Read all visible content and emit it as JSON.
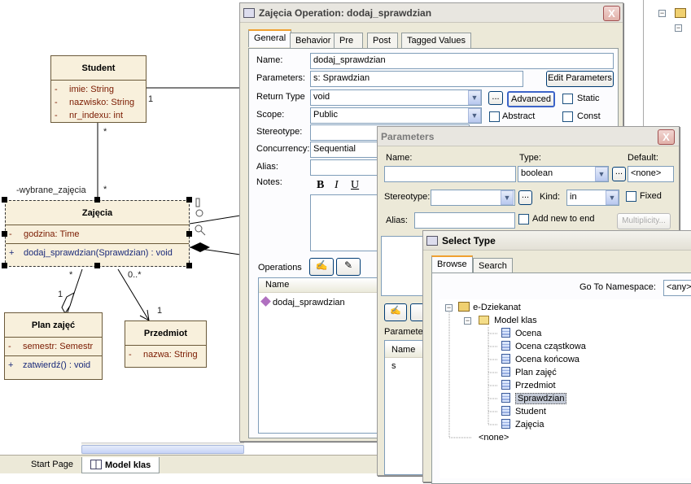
{
  "diagram": {
    "student": {
      "name": "Student",
      "attrs": [
        {
          "vis": "-",
          "text": "imie:  String"
        },
        {
          "vis": "-",
          "text": "nazwisko:  String"
        },
        {
          "vis": "-",
          "text": "nr_indexu:  int"
        }
      ]
    },
    "zajecia": {
      "name": "Zajęcia",
      "attr_vis": "-",
      "attr": "godzina:  Time",
      "op_vis": "+",
      "op": "dodaj_sprawdzian(Sprawdzian) : void"
    },
    "plan": {
      "name": "Plan zajęć",
      "attr_vis": "-",
      "attr": "semestr:  Semestr",
      "op_vis": "+",
      "op": "zatwierdź() : void"
    },
    "przedmiot": {
      "name": "Przedmiot",
      "attr_vis": "-",
      "attr": "nazwa:  String"
    },
    "labels": {
      "role": "-wybrane_zajęcia",
      "m_student_right": "1",
      "m_student_down": "*",
      "m_zaj_top": "*",
      "m_plan_star": "*",
      "m_plan_one": "1",
      "m_przed_star": "0..*",
      "m_przed_one": "1"
    }
  },
  "tabs_bottom": {
    "start_page": "Start Page",
    "model_klas": "Model klas"
  },
  "operation_dialog": {
    "title": "Zajęcia Operation:  dodaj_sprawdzian",
    "close": "X",
    "tabs": [
      "General",
      "Behavior",
      "Pre",
      "Post",
      "Tagged Values"
    ],
    "name_label": "Name:",
    "name_value": "dodaj_sprawdzian",
    "params_label": "Parameters:",
    "params_value": "s: Sprawdzian",
    "edit_params": "Edit Parameters",
    "return_label": "Return Type",
    "return_value": "void",
    "ellipsis": "...",
    "advanced": "Advanced",
    "static": "Static",
    "abstract": "Abstract",
    "const": "Const",
    "scope_label": "Scope:",
    "scope_value": "Public",
    "stereotype_label": "Stereotype:",
    "concurrency_label": "Concurrency:",
    "concurrency_value": "Sequential",
    "alias_label": "Alias:",
    "notes_label": "Notes:",
    "fmt_bold": "B",
    "fmt_italic": "I",
    "fmt_underline": "U",
    "operations_label": "Operations",
    "ops_col_name": "Name",
    "ops_item": "dodaj_sprawdzian"
  },
  "params_dialog": {
    "title": "Parameters",
    "close": "X",
    "name_label": "Name:",
    "type_label": "Type:",
    "type_value": "boolean",
    "ellipsis": "...",
    "default_label": "Default:",
    "default_value": "<none>",
    "stereotype_label": "Stereotype:",
    "kind_label": "Kind:",
    "kind_value": "in",
    "fixed": "Fixed",
    "alias_label": "Alias:",
    "add_new": "Add new to end",
    "multiplicity": "Multiplicity...",
    "parameters_label": "Parameter",
    "col_name": "Name",
    "row": "s"
  },
  "select_type_dialog": {
    "title": "Select Type",
    "tabs": [
      "Browse",
      "Search"
    ],
    "namespace_label": "Go To Namespace:",
    "namespace_value": "<any>",
    "root": "e-Dziekanat",
    "model": "Model klas",
    "items": [
      "Ocena",
      "Ocena cząstkowa",
      "Ocena końcowa",
      "Plan zajęć",
      "Przedmiot",
      "Sprawdzian",
      "Student",
      "Zajęcia"
    ],
    "selected": "Sprawdzian",
    "none_item": "<none>"
  }
}
